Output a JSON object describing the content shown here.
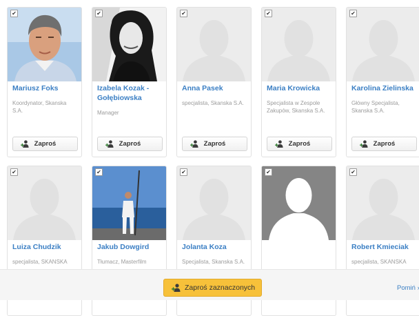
{
  "people": [
    {
      "name": "Mariusz Foks",
      "role": "Koordynator, Skanska S.A.",
      "invite_label": "Zaproś",
      "checked": true,
      "photo": "man-photo"
    },
    {
      "name": "Izabela Kozak - Gołębiowska",
      "role": "Manager",
      "invite_label": "Zaproś",
      "checked": true,
      "photo": "woman-bw-photo"
    },
    {
      "name": "Anna Pasek",
      "role": "specjalista, Skanska S.A.",
      "invite_label": "Zaproś",
      "checked": true,
      "photo": "default-avatar"
    },
    {
      "name": "Maria Krowicka",
      "role": "Specjalista w Zespole Zakupów, Skanska S.A.",
      "invite_label": "Zaproś",
      "checked": true,
      "photo": "default-avatar"
    },
    {
      "name": "Karolina Zielinska",
      "role": "Główny Specjalista, Skanska S.A.",
      "invite_label": "Zaproś",
      "checked": true,
      "photo": "default-avatar"
    },
    {
      "name": "Luiza Chudzik",
      "role": "specjalista, SKANSKA",
      "checked": true,
      "photo": "default-avatar"
    },
    {
      "name": "Jakub Dowgird",
      "role": "Tłumacz, Masterfilm",
      "checked": true,
      "photo": "seaside-photo"
    },
    {
      "name": "Jolanta Koza",
      "role": "Specjalista, Skanska S.A.",
      "checked": true,
      "photo": "default-avatar"
    },
    {
      "name": "",
      "role": "",
      "checked": true,
      "photo": "dark-avatar"
    },
    {
      "name": "Robert Kmieciak",
      "role": "specjalista, SKANSKA",
      "checked": true,
      "photo": "default-avatar"
    }
  ],
  "footer": {
    "invite_selected_label": "Zaproś zaznaczonych",
    "skip_label": "Pomiń »"
  },
  "colors": {
    "accent": "#f7c13a",
    "link": "#3b7fc4",
    "placeholder": "#e1e1e1"
  },
  "icons": {
    "invite": "add-user-icon",
    "check": "checkbox-icon"
  }
}
